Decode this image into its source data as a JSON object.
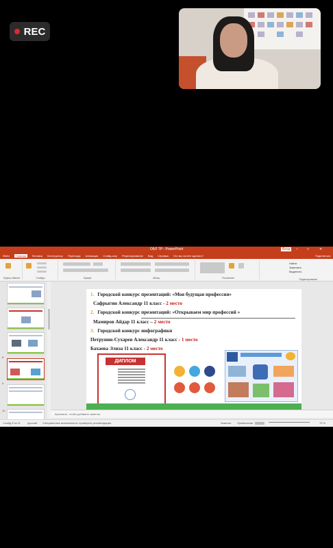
{
  "recording": {
    "label": "REC"
  },
  "window": {
    "title": "ОБЛ ТР - PowerPoint",
    "signin": "Вход",
    "share": "Поделиться"
  },
  "menu": [
    "Файл",
    "Главная",
    "Вставка",
    "Конструктор",
    "Переходы",
    "Анимация",
    "Слайд-шоу",
    "Рецензирование",
    "Вид",
    "Справка",
    "Что вы хотите сделать?"
  ],
  "ribbon": {
    "groups": [
      "Буфер обмена",
      "Слайды",
      "Шрифт",
      "Абзац",
      "Рисование",
      "Редактирование"
    ],
    "find": "Найти",
    "replace": "Заменить",
    "select": "Выделить"
  },
  "thumbnails": [
    "8",
    "9",
    "10"
  ],
  "slide": {
    "line1_num": "1.",
    "line1": "Городской конкурс презентаций: «Моя будущая профессия»",
    "line2_name": "Сафрыгин Александр 11 класс - ",
    "line2_place": "2 место",
    "line3_num": "2.",
    "line3": "Городской конкурс презентаций: «Открываем мир профессий »",
    "line4_name": "Мамиров Айдар  11 класс – ",
    "line4_place": "2 место",
    "line5_num": "3.",
    "line5": "Городской конкурс инфографики",
    "line6_name": "Петрунин-Сухарев Александр 11 класс   - ",
    "line6_place": "1 место",
    "line7_name": "Бахаева  Элиза 11 класс  - ",
    "line7_place": "2 место",
    "diploma": "ДИПЛОМ"
  },
  "notes_placeholder": "Щелкните, чтобы добавить заметки",
  "status": {
    "slide": "Слайд 9 из 11",
    "lang": "русский",
    "access": "Специальные возможности: проверьте рекомендации",
    "notes": "Заметки",
    "comments": "Примечания",
    "zoom": "70 %"
  },
  "colors": {
    "accent": "#c43e1c",
    "place": "#c0191a",
    "number": "#e2a019",
    "green": "#4caf50"
  }
}
